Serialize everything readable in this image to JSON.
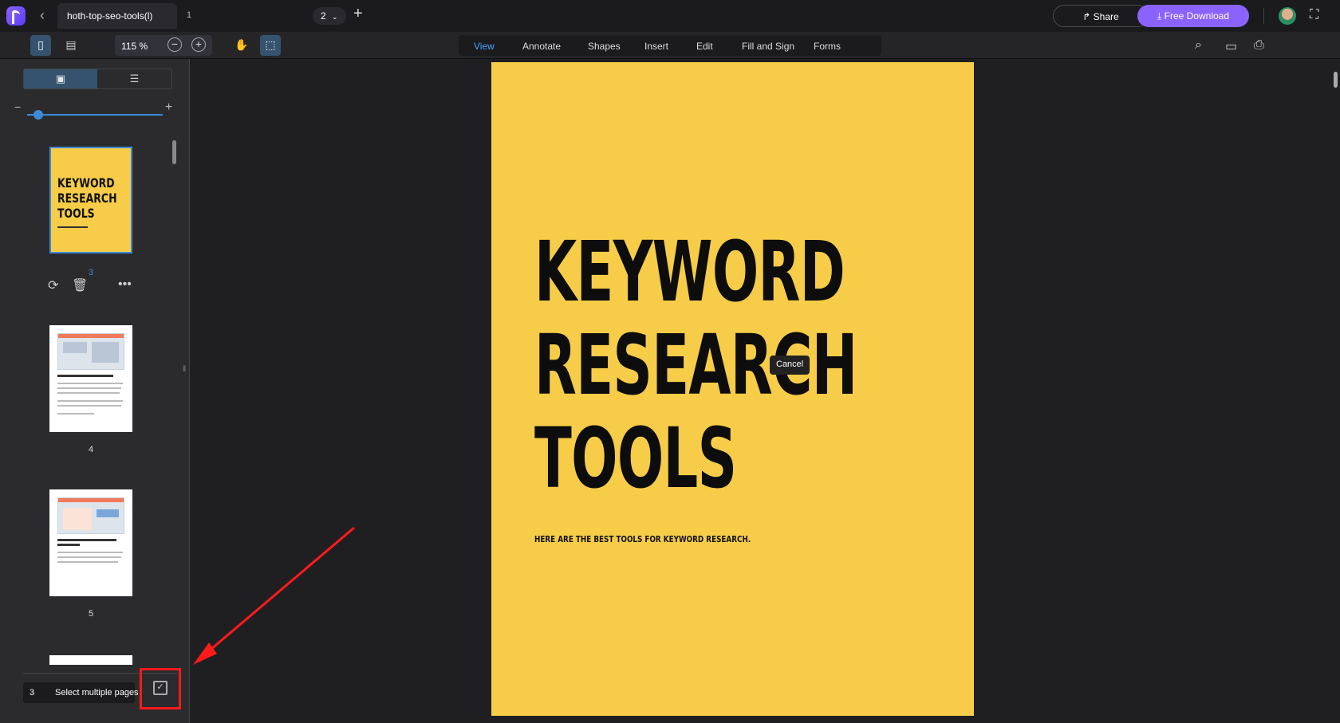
{
  "app": {
    "tab_title": "hoth-top-seo-tools(l)",
    "tab_count": "1",
    "page_select": "2",
    "share_label": "Share",
    "download_label": "Free Download"
  },
  "toolbar": {
    "zoom": "115 %",
    "menu": [
      "View",
      "Annotate",
      "Shapes",
      "Insert",
      "Edit",
      "Fill and Sign",
      "Forms"
    ],
    "active_menu": "View"
  },
  "sidebar": {
    "thumbnails": [
      {
        "page": "3",
        "title_lines": [
          "KEYWORD",
          "RESEARCH",
          "TOOLS"
        ],
        "selected": true
      },
      {
        "page": "4",
        "heading": "Spy On Competitors With SEMRush",
        "selected": false
      },
      {
        "page": "5",
        "heading": "Get Fast Keyword Suggestions With KWFinder",
        "selected": false
      }
    ],
    "current_page": "3",
    "select_multiple_label": "Select multiple pages"
  },
  "document": {
    "title_lines": [
      "KEYWORD",
      "RESEARCH",
      "TOOLS"
    ],
    "subtitle": "HERE ARE THE BEST TOOLS FOR KEYWORD RESEARCH.",
    "tooltip": "Cancel",
    "page_color": "#f6cc48"
  },
  "colors": {
    "accent": "#8a63ff",
    "active_blue": "#3d8bd6",
    "highlight_red": "#ff1a1a"
  }
}
